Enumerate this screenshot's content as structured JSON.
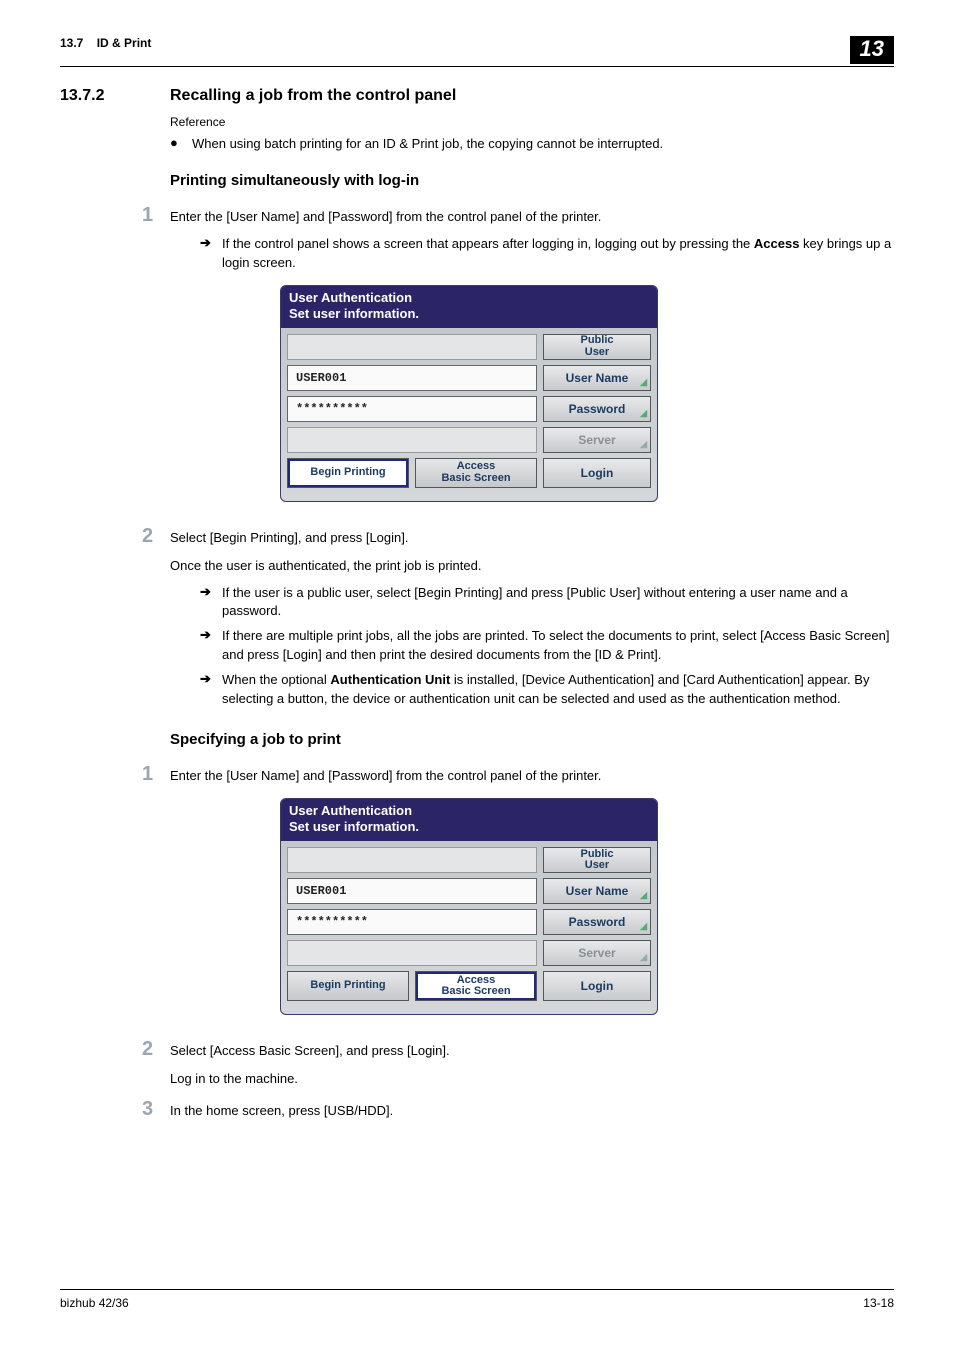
{
  "header": {
    "section_num": "13.7",
    "section_title": "ID & Print",
    "chapter": "13"
  },
  "h2": {
    "num": "13.7.2",
    "title": "Recalling a job from the control panel"
  },
  "ref": {
    "label": "Reference",
    "bullet": "When using batch printing for an ID & Print job, the copying cannot be interrupted."
  },
  "sectA": {
    "heading": "Printing simultaneously with log-in",
    "step1": "Enter the [User Name] and [Password] from the control panel of the printer.",
    "step1_arrow_pre": "If the control panel shows a screen that appears after logging in, logging out by pressing the ",
    "step1_arrow_bold": "Access",
    "step1_arrow_post": " key brings up a login screen.",
    "step2": "Select [Begin Printing], and press [Login].",
    "step2_line": "Once the user is authenticated, the print job is printed.",
    "step2_a1": "If the user is a public user, select [Begin Printing] and press [Public User] without entering a user name and a password.",
    "step2_a2": "If there are multiple print jobs, all the jobs are printed. To select the documents to print, select [Access Basic Screen] and press [Login] and then print the desired documents from the [ID & Print].",
    "step2_a3_pre": "When the optional ",
    "step2_a3_bold": "Authentication Unit",
    "step2_a3_post": " is installed, [Device Authentication] and [Card Authentication] appear. By selecting a button, the device or authentication unit can be selected and used as the authentication method."
  },
  "sectB": {
    "heading": "Specifying a job to print",
    "step1": "Enter the [User Name] and [Password] from the control panel of the printer.",
    "step2": "Select [Access Basic Screen], and press [Login].",
    "step2_line": "Log in to the machine.",
    "step3": "In the home screen, press [USB/HDD]."
  },
  "panelA": {
    "title_l1": "User Authentication",
    "title_l2": "Set user information.",
    "public_user": "Public\nUser",
    "username": "USER001",
    "btn_username": "User Name",
    "password": "**********",
    "btn_password": "Password",
    "btn_server": "Server",
    "begin_printing": "Begin Printing",
    "access_l1": "Access",
    "access_l2": "Basic Screen",
    "login": "Login",
    "selected": "begin"
  },
  "panelB": {
    "title_l1": "User Authentication",
    "title_l2": "Set user information.",
    "public_user": "Public\nUser",
    "username": "USER001",
    "btn_username": "User Name",
    "password": "**********",
    "btn_password": "Password",
    "btn_server": "Server",
    "begin_printing": "Begin Printing",
    "access_l1": "Access",
    "access_l2": "Basic Screen",
    "login": "Login",
    "selected": "access"
  },
  "footer": {
    "left": "bizhub 42/36",
    "right": "13-18"
  }
}
